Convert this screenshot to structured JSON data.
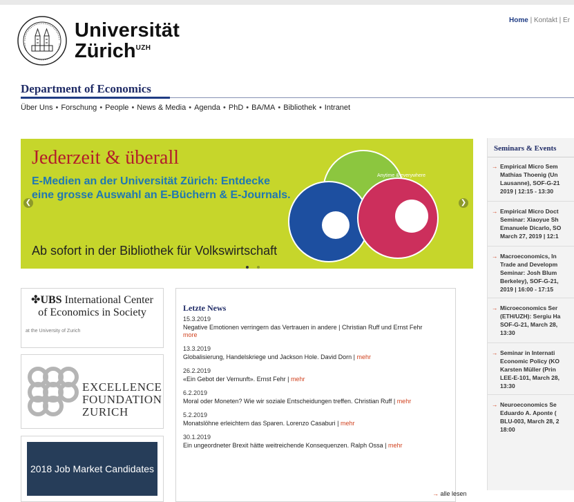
{
  "university": {
    "line1": "Universität",
    "line2": "Zürich",
    "sup": "UZH"
  },
  "toplinks": {
    "home": "Home",
    "contact": "Kontakt",
    "next": "Er"
  },
  "department": "Department of Economics",
  "nav": [
    "Über Uns",
    "Forschung",
    "People",
    "News & Media",
    "Agenda",
    "PhD",
    "BA/MA",
    "Bibliothek",
    "Intranet"
  ],
  "banner": {
    "title": "Jederzeit & überall",
    "subtitle": "E-Medien an der Universität Zürich: Entdecke eine grosse Auswahl an E-Büchern & E-Journals.",
    "footer": "Ab sofort in der Bibliothek für Volkswirtschaft",
    "disc_text": "Anytime & everywhere",
    "colors": {
      "bg": "#c6d62b",
      "title": "#b21c2a",
      "subtitle": "#1f77b3"
    }
  },
  "ubs": {
    "name": "UBS",
    "line1": "International Center",
    "line2": "of Economics in Society",
    "sub": "at the University of Zurich"
  },
  "excellence": {
    "line1": "EXCELLENCE",
    "line2": "FOUNDATION",
    "line3": "ZURICH"
  },
  "job_market": "2018 Job Market Candidates",
  "news": {
    "heading": "Letzte News",
    "items": [
      {
        "date": "15.3.2019",
        "text": "Negative Emotionen verringern das Vertrauen in andere | Christian Ruff und Ernst Fehr",
        "link": "more"
      },
      {
        "date": "13.3.2019",
        "text": "Globalisierung, Handelskriege und Jackson Hole. David Dorn |",
        "link": "mehr"
      },
      {
        "date": "26.2.2019",
        "text": "«Ein Gebot der Vernunft». Ernst Fehr |",
        "link": "mehr"
      },
      {
        "date": "6.2.2019",
        "text": "Moral oder Moneten? Wie wir soziale Entscheidungen treffen. Christian Ruff |",
        "link": "mehr"
      },
      {
        "date": "5.2.2019",
        "text": "Monatslöhne erleichtern das Sparen. Lorenzo Casaburi |",
        "link": "mehr"
      },
      {
        "date": "30.1.2019",
        "text": "Ein ungeordneter Brexit hätte weitreichende Konsequenzen. Ralph Ossa |",
        "link": "mehr"
      }
    ],
    "all": "alle lesen"
  },
  "seminars": {
    "title": "Seminars & Events",
    "events": [
      {
        "l1": "Empirical Micro Sem",
        "l2": "Mathias Thoenig (Un",
        "l3": "Lausanne), SOF-G-21",
        "l4": "2019 | 12:15 - 13:30"
      },
      {
        "l1": "Empirical Micro Doct",
        "l2": "Seminar: Xiaoyue Sh",
        "l3": "Emanuele Dicarlo, SO",
        "l4": "March 27, 2019 | 12:1"
      },
      {
        "l1": "Macroeconomics, In",
        "l2": "Trade and Developm",
        "l3": "Seminar: Josh Blum",
        "l4": "Berkeley), SOF-G-21,",
        "l5": "2019 | 16:00 - 17:15"
      },
      {
        "l1": "Microeconomics Ser",
        "l2": "(ETH/UZH): Sergiu Ha",
        "l3": "SOF-G-21, March 28,",
        "l4": "13:30"
      },
      {
        "l1": "Seminar in Internati",
        "l2": "Economic Policy (KO",
        "l3": "Karsten Müller (Prin",
        "l4": "LEE-E-101, March 28,",
        "l5": "13:30"
      },
      {
        "l1": "Neuroeconomics Se",
        "l2": "Eduardo A. Aponte (",
        "l3": "BLU-003, March 28, 2",
        "l4": "18:00"
      }
    ]
  }
}
